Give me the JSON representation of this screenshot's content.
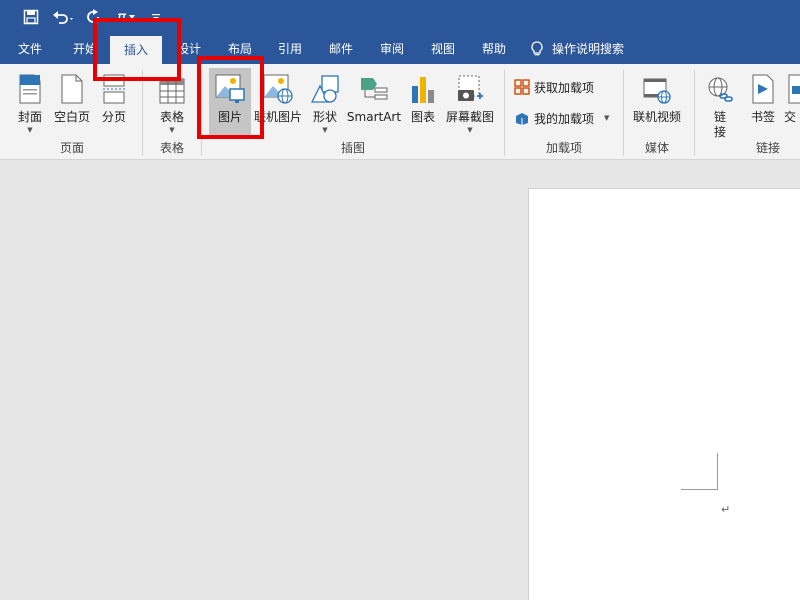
{
  "quick_access": {
    "save_icon": "save-icon",
    "undo_icon": "undo-icon",
    "redo_icon": "redo-icon",
    "equation_symbol": "π",
    "customize_icon": "customize-qat-icon"
  },
  "tabs": [
    {
      "label": "文件"
    },
    {
      "label": "开始"
    },
    {
      "label": "插入"
    },
    {
      "label": "设计"
    },
    {
      "label": "布局"
    },
    {
      "label": "引用"
    },
    {
      "label": "邮件"
    },
    {
      "label": "审阅"
    },
    {
      "label": "视图"
    },
    {
      "label": "帮助"
    }
  ],
  "tell_me": {
    "label": "操作说明搜索",
    "icon": "lightbulb-icon"
  },
  "ribbon": {
    "pages_group": {
      "label": "页面",
      "cover": "封面",
      "blank_page": "空白页",
      "page_break": "分页"
    },
    "tables_group": {
      "label": "表格",
      "table": "表格"
    },
    "illustrations_group": {
      "label": "插图",
      "pictures": "图片",
      "online_pictures": "联机图片",
      "shapes": "形状",
      "smartart": "SmartArt",
      "chart": "图表",
      "screenshot": "屏幕截图"
    },
    "addins_group": {
      "label": "加载项",
      "get_addins": "获取加载项",
      "my_addins": "我的加载项"
    },
    "media_group": {
      "label": "媒体",
      "online_video": "联机视频"
    },
    "links_group": {
      "label": "链接",
      "link": "链接",
      "bookmark": "书签",
      "cross_reference": "交"
    }
  },
  "colors": {
    "title_bar": "#2b579a",
    "ribbon_bg": "#f3f3f3",
    "highlight": "#e60000"
  }
}
